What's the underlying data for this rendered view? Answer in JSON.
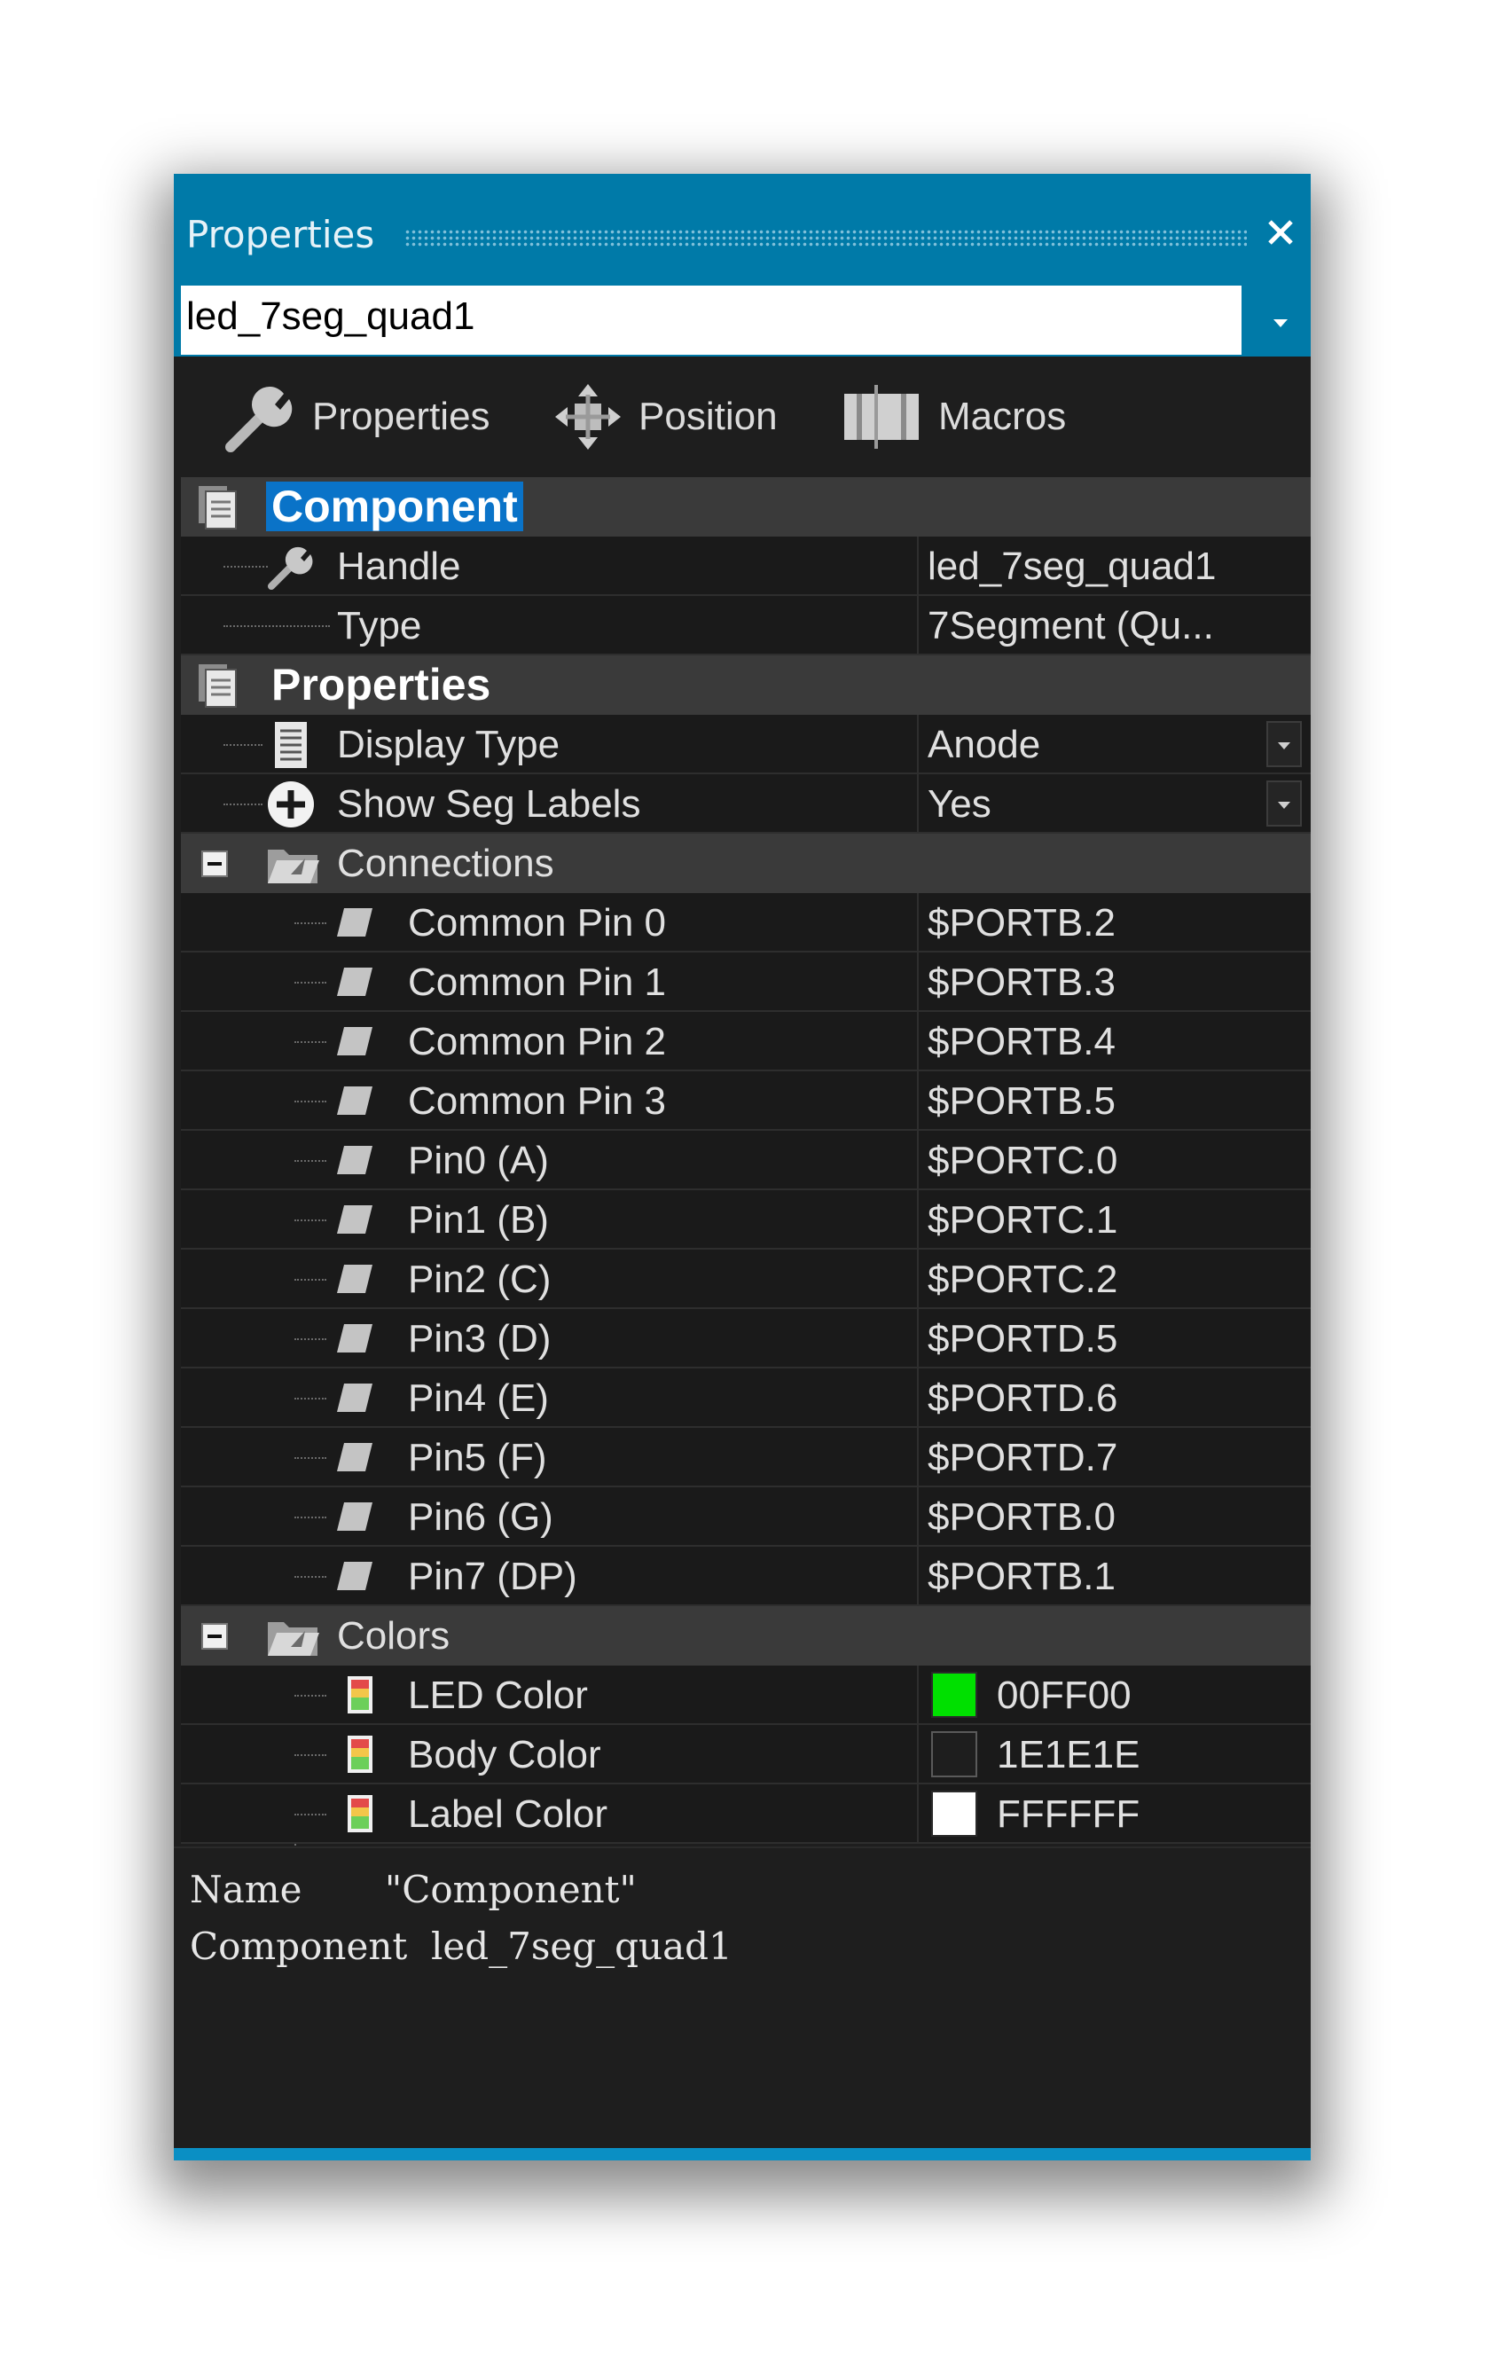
{
  "window": {
    "title": "Properties",
    "close_icon": "close-icon"
  },
  "selector": {
    "value": "led_7seg_quad1"
  },
  "toolbar": {
    "properties_label": "Properties",
    "position_label": "Position",
    "macros_label": "Macros"
  },
  "grid": {
    "component_category": "Component",
    "handle_label": "Handle",
    "handle_value": "led_7seg_quad1",
    "type_label": "Type",
    "type_value": "7Segment (Qu...",
    "properties_category": "Properties",
    "display_type_label": "Display Type",
    "display_type_value": "Anode",
    "show_seg_labels_label": "Show Seg Labels",
    "show_seg_labels_value": "Yes",
    "connections_label": "Connections",
    "connections": [
      {
        "label": "Common Pin 0",
        "value": "$PORTB.2"
      },
      {
        "label": "Common Pin 1",
        "value": "$PORTB.3"
      },
      {
        "label": "Common Pin 2",
        "value": "$PORTB.4"
      },
      {
        "label": "Common Pin 3",
        "value": "$PORTB.5"
      },
      {
        "label": "Pin0 (A)",
        "value": "$PORTC.0"
      },
      {
        "label": "Pin1 (B)",
        "value": "$PORTC.1"
      },
      {
        "label": "Pin2 (C)",
        "value": "$PORTC.2"
      },
      {
        "label": "Pin3 (D)",
        "value": "$PORTD.5"
      },
      {
        "label": "Pin4 (E)",
        "value": "$PORTD.6"
      },
      {
        "label": "Pin5 (F)",
        "value": "$PORTD.7"
      },
      {
        "label": "Pin6 (G)",
        "value": "$PORTB.0"
      },
      {
        "label": "Pin7 (DP)",
        "value": "$PORTB.1"
      }
    ],
    "colors_label": "Colors",
    "colors": [
      {
        "label": "LED Color",
        "value": "00FF00",
        "swatch": "#00e000"
      },
      {
        "label": "Body Color",
        "value": "1E1E1E",
        "swatch": "#1e1e1e"
      },
      {
        "label": "Label Color",
        "value": "FFFFFF",
        "swatch": "#ffffff"
      }
    ]
  },
  "description": {
    "line1": "Name       \"Component\"",
    "line2": "Component  led_7seg_quad1"
  },
  "theme": {
    "accent": "#007aa8",
    "background": "#1e1e1e",
    "category": "#3a3a3a",
    "selection": "#0a73c8"
  }
}
